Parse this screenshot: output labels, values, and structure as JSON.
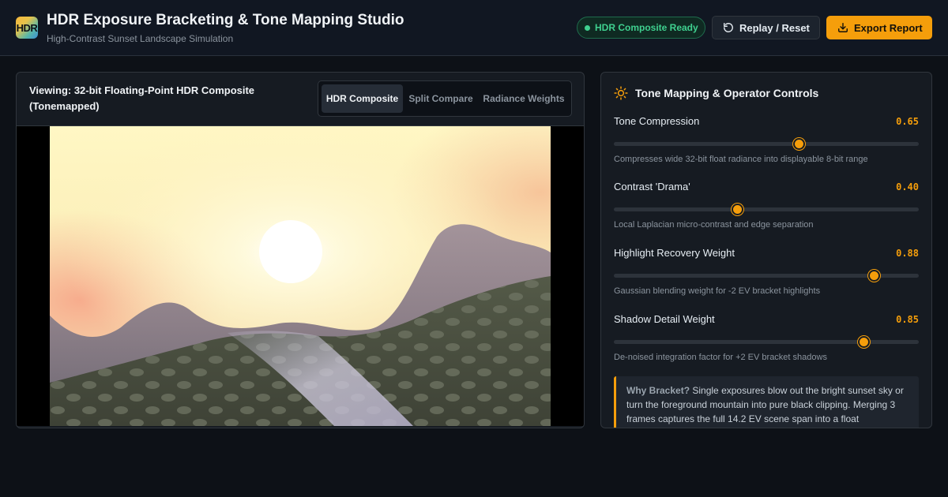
{
  "header": {
    "logo_text": "HDR",
    "title": "HDR Exposure Bracketing & Tone Mapping Studio",
    "subtitle": "High-Contrast Sunset Landscape Simulation",
    "status": "HDR Composite Ready",
    "replay_label": "Replay / Reset",
    "export_label": "Export Report"
  },
  "viewer": {
    "title": "Viewing: 32-bit Floating-Point HDR Composite (Tonemapped)",
    "tabs": [
      {
        "label": "HDR Composite",
        "active": true
      },
      {
        "label": "Split Compare",
        "active": false
      },
      {
        "label": "Radiance Weights",
        "active": false
      }
    ]
  },
  "controls": {
    "title": "Tone Mapping & Operator Controls",
    "sliders": [
      {
        "label": "Tone Compression",
        "value": 0.65,
        "display": "0.65",
        "fraction": 0.605,
        "desc": "Compresses wide 32-bit float radiance into displayable 8-bit range"
      },
      {
        "label": "Contrast 'Drama'",
        "value": 0.4,
        "display": "0.40",
        "fraction": 0.405,
        "desc": "Local Laplacian micro-contrast and edge separation"
      },
      {
        "label": "Highlight Recovery Weight",
        "value": 0.88,
        "display": "0.88",
        "fraction": 0.852,
        "desc": "Gaussian blending weight for -2 EV bracket highlights"
      },
      {
        "label": "Shadow Detail Weight",
        "value": 0.85,
        "display": "0.85",
        "fraction": 0.818,
        "desc": "De-noised integration factor for +2 EV bracket shadows"
      }
    ],
    "info": {
      "heading": "Why Bracket?",
      "text": "Single exposures blow out the bright sunset sky or turn the foreground mountain into pure black clipping. Merging 3 frames captures the full 14.2 EV scene span into a float"
    }
  },
  "colors": {
    "accent": "#f59e0b",
    "status_green": "#3fd08f",
    "background": "#0d1117",
    "panel": "#161b22"
  },
  "icons": {
    "replay": "rotate-ccw-icon",
    "export": "download-icon",
    "controls": "sun-icon"
  }
}
